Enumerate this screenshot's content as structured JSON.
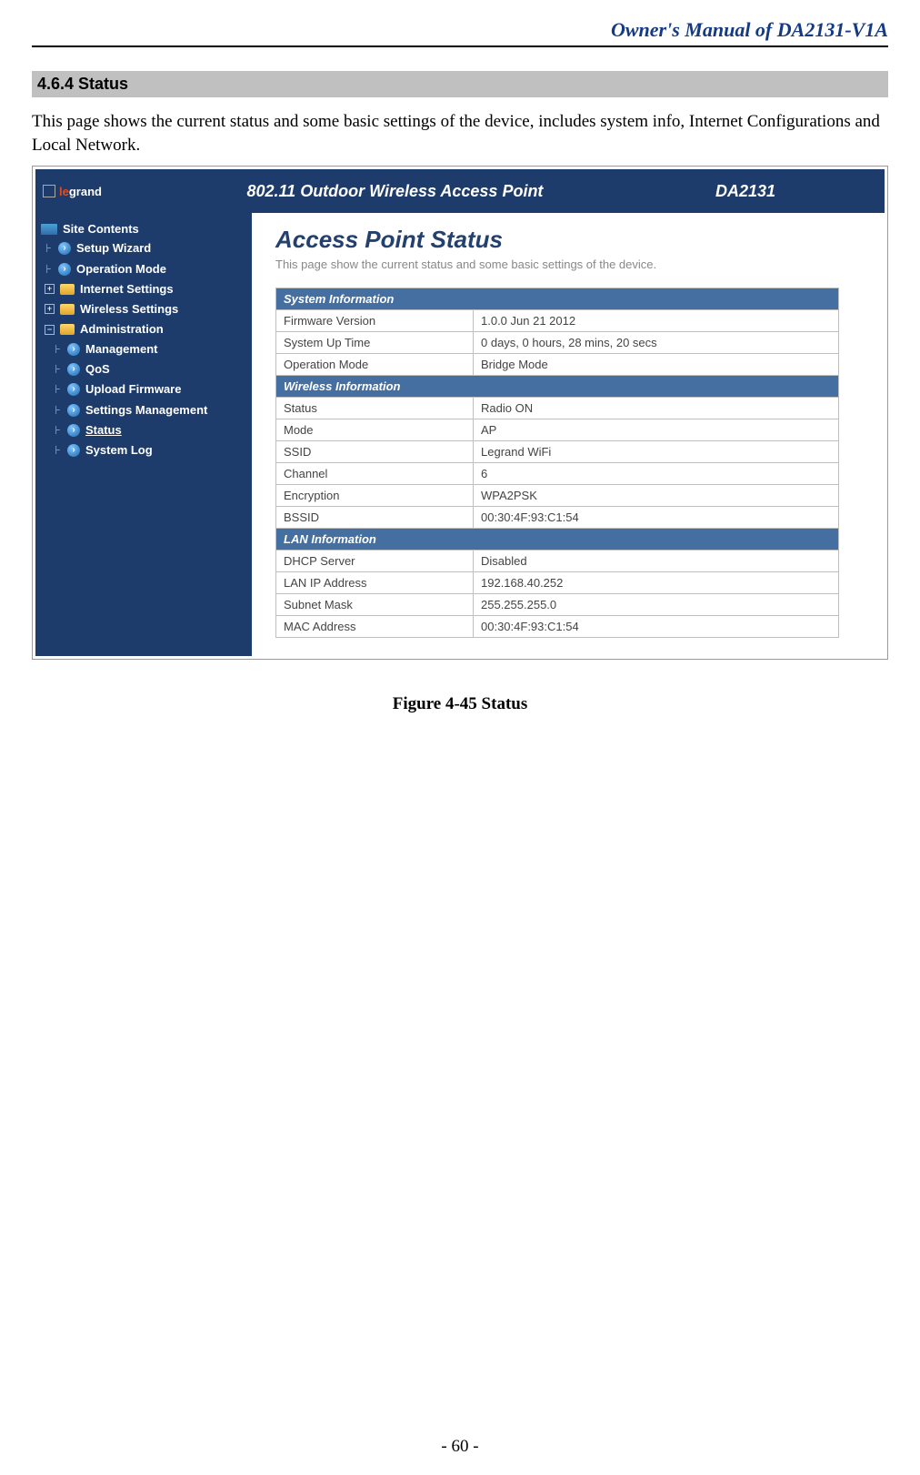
{
  "doc": {
    "header": "Owner's Manual of DA2131-V1A",
    "section_heading": "4.6.4  Status",
    "body_text": "This page shows the current status and some basic settings of the device, includes system info, Internet Configurations and Local Network.",
    "figure_caption": "Figure 4-45 Status",
    "page_number": "- 60 -"
  },
  "screenshot": {
    "logo_part1": "le",
    "logo_part2": "grand",
    "banner_title": "802.11 Outdoor Wireless Access Point",
    "model": "DA2131",
    "sidebar_root": "Site Contents",
    "nav": {
      "setup_wizard": "Setup Wizard",
      "operation_mode": "Operation Mode",
      "internet_settings": "Internet Settings",
      "wireless_settings": "Wireless Settings",
      "administration": "Administration",
      "management": "Management",
      "qos": "QoS",
      "upload_firmware": "Upload Firmware",
      "settings_management": "Settings Management",
      "status": "Status",
      "system_log": "System Log"
    },
    "page_title": "Access Point Status",
    "page_desc": "This page show the current status and some basic settings of the device.",
    "sections": {
      "system": "System Information",
      "wireless": "Wireless Information",
      "lan": "LAN Information"
    },
    "rows": {
      "firmware_k": "Firmware Version",
      "firmware_v": "1.0.0 Jun 21 2012",
      "uptime_k": "System Up Time",
      "uptime_v": "0 days, 0 hours, 28 mins, 20 secs",
      "opmode_k": "Operation Mode",
      "opmode_v": "Bridge Mode",
      "status_k": "Status",
      "status_v": "Radio ON",
      "mode_k": "Mode",
      "mode_v": "AP",
      "ssid_k": "SSID",
      "ssid_v": "Legrand WiFi",
      "channel_k": "Channel",
      "channel_v": "6",
      "enc_k": "Encryption",
      "enc_v": "WPA2PSK",
      "bssid_k": "BSSID",
      "bssid_v": "00:30:4F:93:C1:54",
      "dhcp_k": "DHCP Server",
      "dhcp_v": "Disabled",
      "lanip_k": "LAN IP Address",
      "lanip_v": "192.168.40.252",
      "subnet_k": "Subnet Mask",
      "subnet_v": "255.255.255.0",
      "mac_k": "MAC Address",
      "mac_v": "00:30:4F:93:C1:54"
    }
  }
}
